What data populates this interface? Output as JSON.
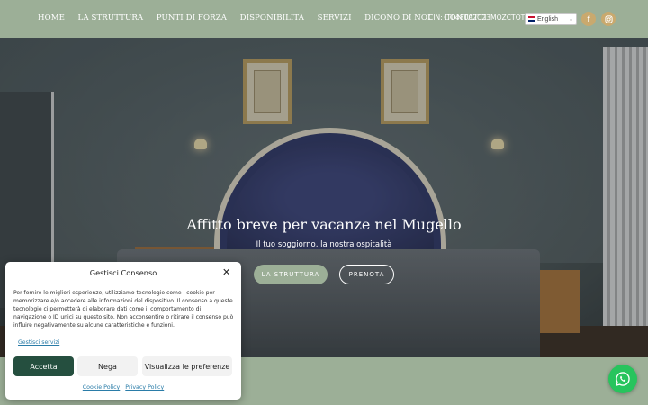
{
  "nav": {
    "items": [
      "HOME",
      "LA STRUTTURA",
      "PUNTI DI FORZA",
      "DISPONIBILITÀ",
      "SERVIZI",
      "DICONO DI NOI",
      "CONTATTI"
    ],
    "cin": "CIN: IT048002C23MOZCTOT",
    "language": "English"
  },
  "social": {
    "facebook": "f",
    "instagram_icon": "instagram-icon"
  },
  "hero": {
    "title": "Affitto breve per vacanze nel Mugello",
    "subtitle": "Il tuo soggiorno, la nostra ospitalità",
    "btn_struttura": "LA STRUTTURA",
    "btn_prenota": "PRENOTA"
  },
  "consent": {
    "title": "Gestisci Consenso",
    "text": "Per fornire le migliori esperienze, utilizziamo tecnologie come i cookie per memorizzare e/o accedere alle informazioni del dispositivo. Il consenso a queste tecnologie ci permetterà di elaborare dati come il comportamento di navigazione o ID unici su questo sito. Non acconsentire o ritirare il consenso può influire negativamente su alcune caratteristiche e funzioni.",
    "manage": "Gestisci servizi",
    "accept": "Accetta",
    "deny": "Nega",
    "prefs": "Visualizza le preferenze",
    "cookie_policy": "Cookie Policy",
    "privacy_policy": "Privacy Policy"
  },
  "colors": {
    "header_green": "#9caf97",
    "accept_green": "#254f3f",
    "whatsapp": "#27c45d",
    "social_gold": "#c9a96e"
  }
}
